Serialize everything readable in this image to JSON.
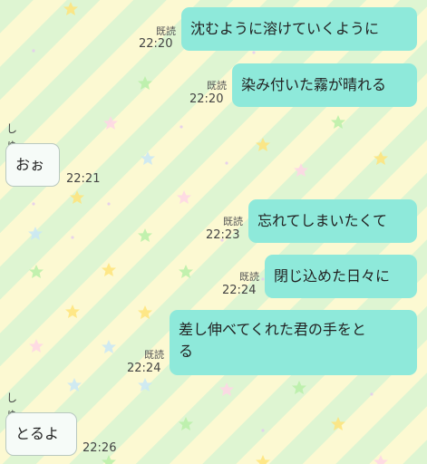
{
  "theme": {
    "accent": "#8ee9da",
    "background": "#fcf9d2",
    "stripe": "#dcf5d2"
  },
  "messages": [
    {
      "side": "mine",
      "text": "沈むように溶けていくように",
      "read": "既読",
      "time": "22:20"
    },
    {
      "side": "mine",
      "text": "染み付いた霧が晴れる",
      "read": "既読",
      "time": "22:20"
    },
    {
      "side": "theirs",
      "sender": "しゅんや",
      "text": "おぉ",
      "time": "22:21"
    },
    {
      "side": "mine",
      "text": "忘れてしまいたくて",
      "read": "既読",
      "time": "22:23"
    },
    {
      "side": "mine",
      "text": "閉じ込めた日々に",
      "read": "既読",
      "time": "22:24"
    },
    {
      "side": "mine",
      "text_line1": "差し伸べてくれた君の手をと",
      "text_line2": "る",
      "read": "既読",
      "time": "22:24"
    },
    {
      "side": "theirs",
      "sender": "しゅんや",
      "text": "とるよ",
      "time": "22:26"
    }
  ]
}
